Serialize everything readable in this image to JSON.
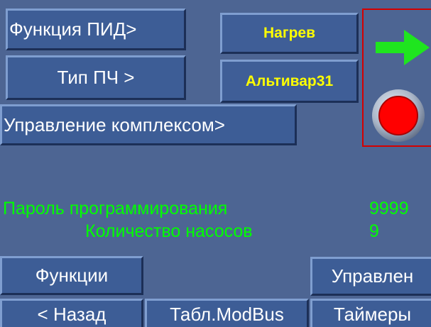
{
  "buttons": {
    "pid_function": "Функция ПИД>",
    "freq_type": "Тип ПЧ >",
    "complex_control": "Управление комплексом>",
    "functions": "Функции",
    "control": "Управлен",
    "back": "< Назад",
    "modbus_table": "Табл.ModBus",
    "timers": "Таймеры"
  },
  "displays": {
    "mode": "Нагрев",
    "drive_model": "Альтивар31"
  },
  "indicators": {
    "direction_arrow_color": "#1fe51f",
    "status_lamp_color": "#ff0000"
  },
  "params": {
    "password_label": "Пароль программирования",
    "password_value": "9999",
    "pumps_label": "Количество насосов",
    "pumps_value": "9"
  },
  "colors": {
    "background": "#4d6593",
    "button": "#3d5d96",
    "param_text": "#00ff00",
    "display_text": "#ffff00",
    "frame": "#d40000"
  }
}
